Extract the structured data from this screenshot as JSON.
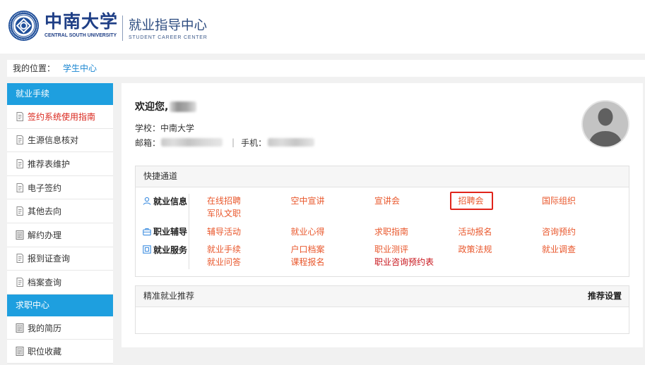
{
  "header": {
    "logo_icon": "university-seal-icon",
    "logo_cn": "中南大学",
    "logo_en": "CENTRAL SOUTH UNIVERSITY",
    "center_cn": "就业指导中心",
    "center_en": "STUDENT CAREER CENTER"
  },
  "breadcrumb": {
    "label": "我的位置：",
    "current": "学生中心"
  },
  "sidebar": {
    "sections": [
      {
        "title": "就业手续",
        "items": [
          {
            "text": "签约系统使用指南",
            "icon": "document-icon",
            "active": true
          },
          {
            "text": "生源信息核对",
            "icon": "document-icon"
          },
          {
            "text": "推荐表维护",
            "icon": "document-icon"
          },
          {
            "text": "电子签约",
            "icon": "document-icon"
          },
          {
            "text": "其他去向",
            "icon": "document-icon"
          },
          {
            "text": "解约办理",
            "icon": "list-box-icon"
          },
          {
            "text": "报到证查询",
            "icon": "document-icon"
          },
          {
            "text": "档案查询",
            "icon": "document-icon"
          }
        ]
      },
      {
        "title": "求职中心",
        "items": [
          {
            "text": "我的简历",
            "icon": "list-box-icon"
          },
          {
            "text": "职位收藏",
            "icon": "list-box-icon"
          }
        ]
      }
    ]
  },
  "profile": {
    "welcome": "欢迎您,",
    "school_label": "学校：",
    "school": "中南大学",
    "email_label": "邮箱：",
    "separator": "|",
    "phone_label": "手机：",
    "avatar_icon": "default-avatar-icon"
  },
  "quick_access": {
    "title": "快捷通道",
    "groups": [
      {
        "label": "就业信息",
        "icon": "user-icon",
        "links": [
          {
            "text": "在线招聘"
          },
          {
            "text": "空中宣讲"
          },
          {
            "text": "宣讲会"
          },
          {
            "text": "招聘会",
            "highlighted": true
          },
          {
            "text": "国际组织"
          },
          {
            "text": "军队文职"
          }
        ]
      },
      {
        "label": "职业辅导",
        "icon": "briefcase-icon",
        "links": [
          {
            "text": "辅导活动"
          },
          {
            "text": "就业心得"
          },
          {
            "text": "求职指南"
          },
          {
            "text": "活动报名"
          },
          {
            "text": "咨询预约"
          }
        ]
      },
      {
        "label": "就业服务",
        "icon": "service-icon",
        "links": [
          {
            "text": "就业手续"
          },
          {
            "text": "户口档案"
          },
          {
            "text": "职业测评"
          },
          {
            "text": "政策法规"
          },
          {
            "text": "就业调查"
          },
          {
            "text": "就业问答"
          },
          {
            "text": "课程报名"
          },
          {
            "text": "职业咨询预约表",
            "color": "#c8161d"
          }
        ]
      }
    ]
  },
  "recommend": {
    "title": "精准就业推荐",
    "settings": "推荐设置"
  },
  "colors": {
    "brand_blue": "#1e9fdf",
    "link": "#e9582d",
    "active_text": "#d9261c",
    "highlight_border": "#e0241b",
    "header_navy": "#1f3f86",
    "breadcrumb_link": "#1b87d2",
    "quick_icon": "#3d8de0"
  }
}
